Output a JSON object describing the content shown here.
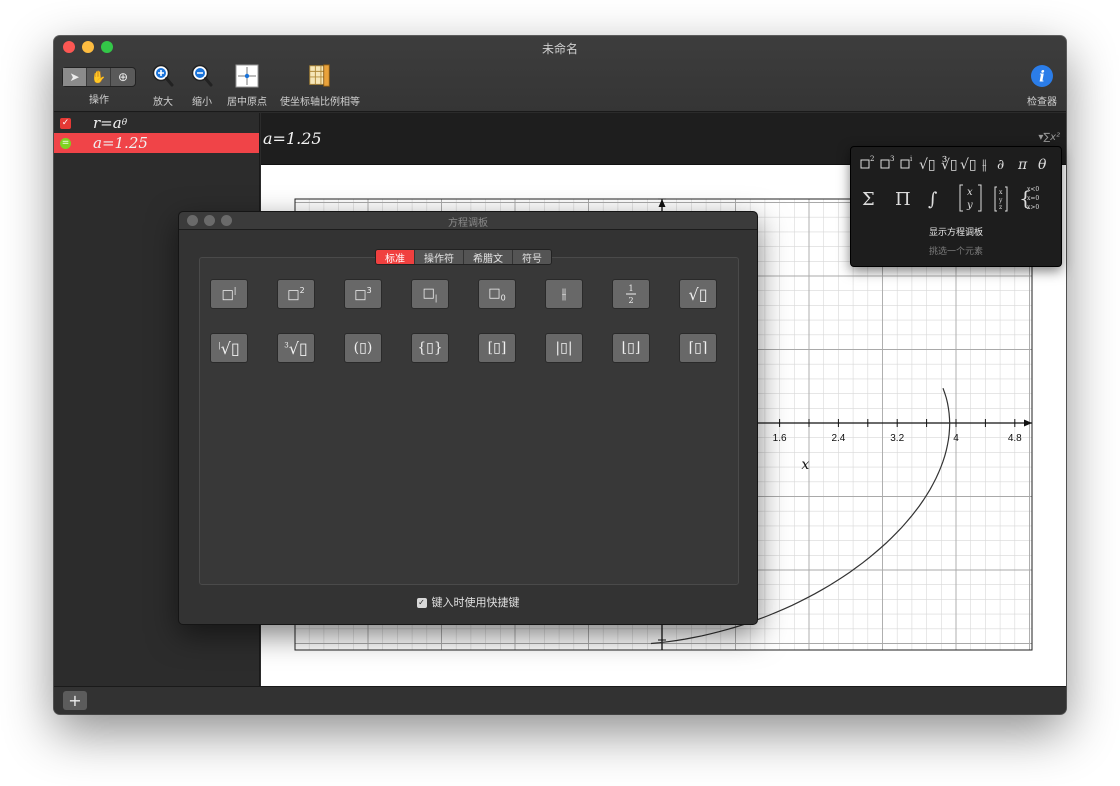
{
  "window": {
    "title": "未命名"
  },
  "toolbar": {
    "operate_label": "操作",
    "zoom_in_label": "放大",
    "zoom_out_label": "缩小",
    "center_origin_label": "居中原点",
    "equal_scale_label": "使坐标轴比例相等",
    "inspector_label": "检查器"
  },
  "equations": [
    {
      "text": "r=a",
      "superscript": "θ",
      "kind": "polar",
      "checked": true
    },
    {
      "text": "a=1.25",
      "kind": "constant",
      "selected": true
    }
  ],
  "editor": {
    "current": "a=1.25",
    "toggle_symbol": "▾∑x²"
  },
  "graph": {
    "x_ticks": [
      "1.6",
      "2.4",
      "3.2",
      "4",
      "4.8"
    ],
    "x_axis_label": "x"
  },
  "popover": {
    "title": "显示方程调板",
    "subtitle": "挑选一个元素"
  },
  "palette": {
    "title": "方程调板",
    "tabs": [
      "标准",
      "操作符",
      "希腊文",
      "符号"
    ],
    "active_tab": "标准",
    "shortcut_label": "键入时使用快捷键",
    "shortcut_checked": true
  },
  "colors": {
    "accent": "#f0403f",
    "selection": "#f04448",
    "curve": "#333333",
    "grid": "#d8d8d8"
  }
}
